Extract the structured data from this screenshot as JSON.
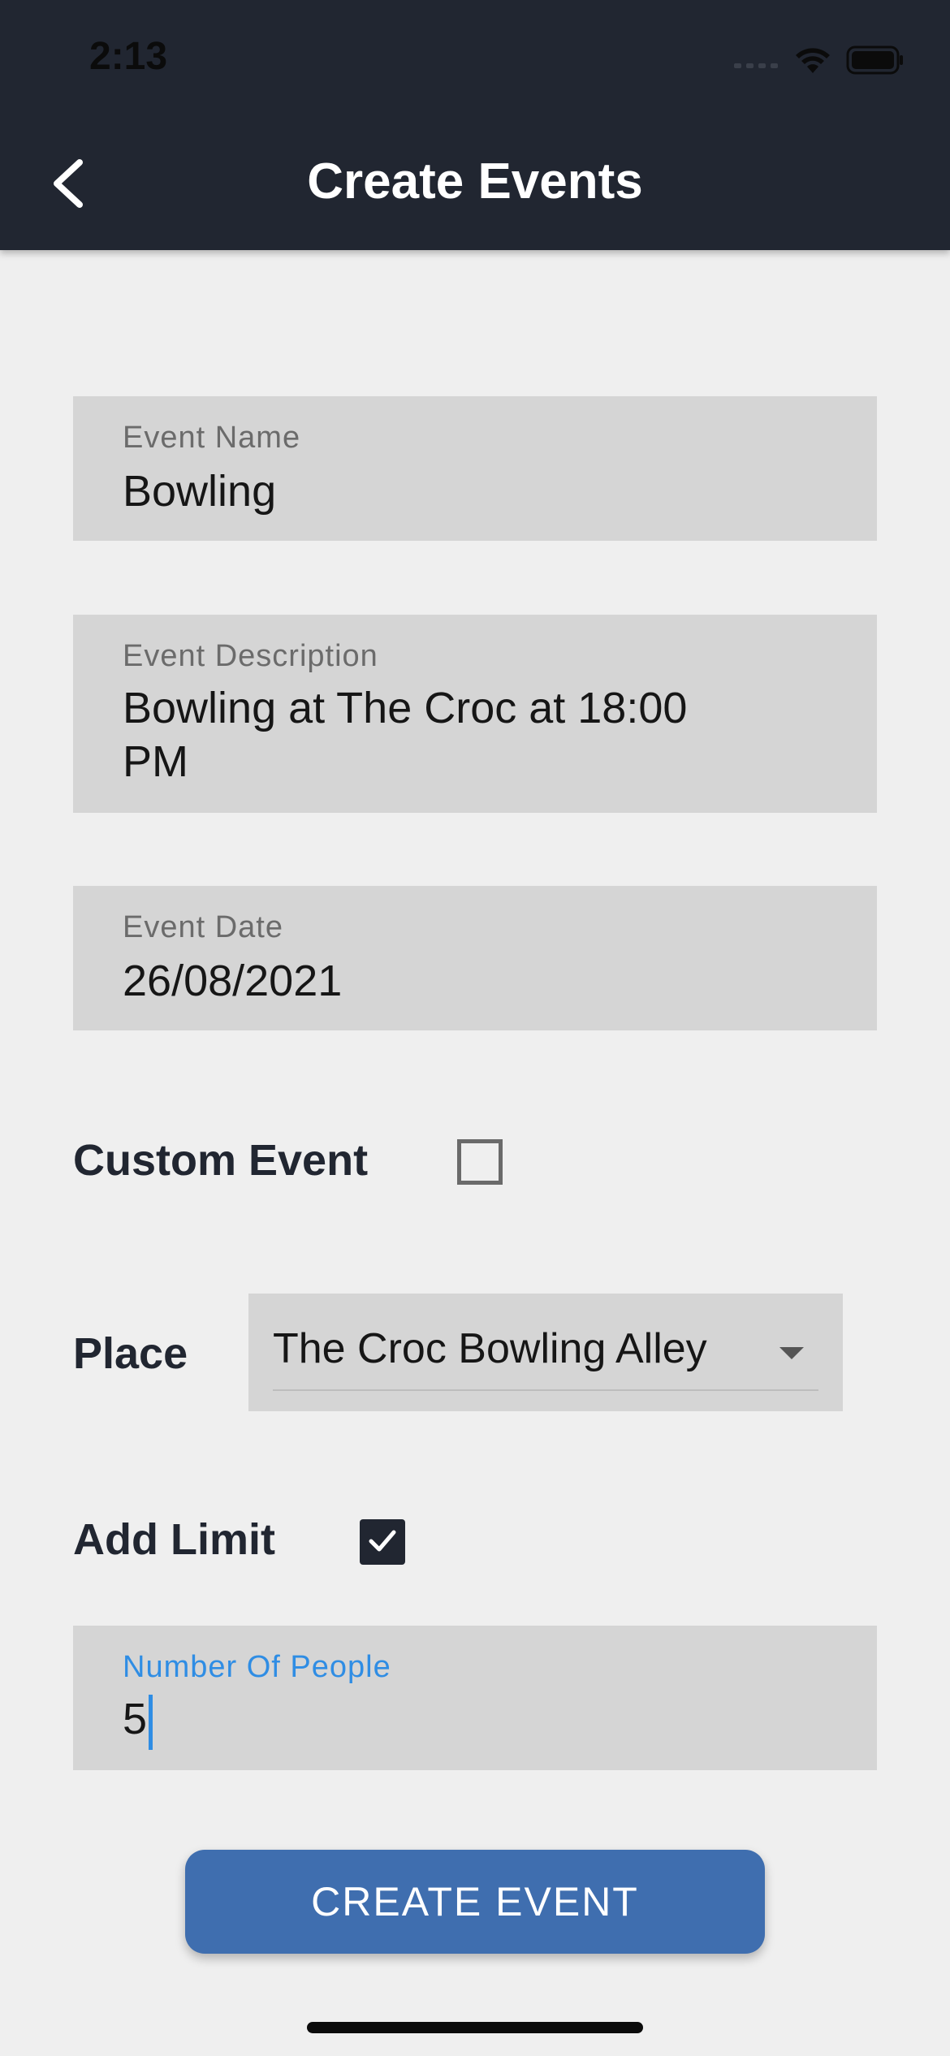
{
  "status_bar": {
    "time": "2:13"
  },
  "header": {
    "title": "Create Events",
    "back_icon": "chevron-left-icon"
  },
  "form": {
    "event_name": {
      "label": "Event Name",
      "value": "Bowling"
    },
    "event_description": {
      "label": "Event Description",
      "value": "Bowling at The Croc at 18:00 PM"
    },
    "event_date": {
      "label": "Event Date",
      "value": "26/08/2021"
    },
    "custom_event": {
      "label": "Custom Event",
      "checked": false
    },
    "place": {
      "label": "Place",
      "selected": "The Croc Bowling Alley"
    },
    "add_limit": {
      "label": "Add Limit",
      "checked": true
    },
    "number_of_people": {
      "label": "Number Of People",
      "value": "5",
      "focused": true
    }
  },
  "actions": {
    "create_label": "CREATE EVENT"
  },
  "colors": {
    "header_bg": "#212631",
    "page_bg": "#efefef",
    "field_bg": "#d5d5d5",
    "accent_blue": "#2f8de4",
    "button_bg": "#3f6eaf"
  }
}
